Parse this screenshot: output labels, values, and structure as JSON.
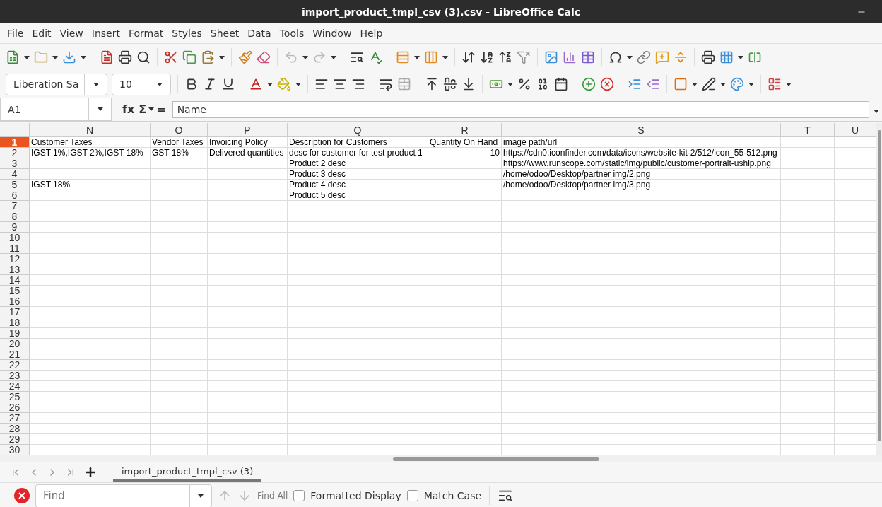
{
  "window": {
    "title": "import_product_tmpl_csv (3).csv - LibreOffice Calc"
  },
  "menu": [
    "File",
    "Edit",
    "View",
    "Insert",
    "Format",
    "Styles",
    "Sheet",
    "Data",
    "Tools",
    "Window",
    "Help"
  ],
  "history": {
    "undo": {
      "disabled": true
    },
    "redo": {
      "disabled": true
    }
  },
  "formatting": {
    "font": "Liberation Sa",
    "size": "10"
  },
  "formula_bar": {
    "cell": "A1",
    "function_label": "fx",
    "sum_label": "Σ",
    "equals_label": "=",
    "content": "Name"
  },
  "columns": [
    "N",
    "O",
    "P",
    "Q",
    "R",
    "S",
    "T",
    "U"
  ],
  "rows": [
    {
      "number": "1",
      "selected": true,
      "cells": [
        {
          "text": "Customer Taxes",
          "kind": "text"
        },
        {
          "text": "Vendor Taxes",
          "kind": "text"
        },
        {
          "text": "Invoicing Policy",
          "kind": "text"
        },
        {
          "text": "Description for Customers",
          "kind": "text"
        },
        {
          "text": "Quantity On Hand",
          "kind": "text"
        },
        {
          "text": "image path/url",
          "kind": "text"
        },
        null,
        null
      ]
    },
    {
      "number": "2",
      "selected": false,
      "cells": [
        {
          "text": "IGST 1%,IGST 2%,IGST 18%",
          "kind": "text"
        },
        {
          "text": "GST 18%",
          "kind": "text"
        },
        {
          "text": "Delivered quantities",
          "kind": "text"
        },
        {
          "text": "desc for customer for test product 1",
          "kind": "text"
        },
        {
          "text": "10",
          "kind": "number"
        },
        {
          "text": "https://cdn0.iconfinder.com/data/icons/website-kit-2/512/icon_55-512.png",
          "kind": "text"
        },
        null,
        null
      ]
    },
    {
      "number": "3",
      "selected": false,
      "cells": [
        null,
        null,
        null,
        {
          "text": "Product 2 desc",
          "kind": "text"
        },
        null,
        {
          "text": "https://www.runscope.com/static/img/public/customer-portrait-uship.png",
          "kind": "text"
        },
        null,
        null
      ]
    },
    {
      "number": "4",
      "selected": false,
      "cells": [
        null,
        null,
        null,
        {
          "text": "Product 3 desc",
          "kind": "text"
        },
        null,
        {
          "text": "/home/odoo/Desktop/partner img/2.png",
          "kind": "text"
        },
        null,
        null
      ]
    },
    {
      "number": "5",
      "selected": false,
      "cells": [
        {
          "text": "IGST 18%",
          "kind": "text"
        },
        null,
        null,
        {
          "text": "Product 4 desc",
          "kind": "text"
        },
        null,
        {
          "text": "/home/odoo/Desktop/partner img/3.png",
          "kind": "text"
        },
        null,
        null
      ]
    },
    {
      "number": "6",
      "selected": false,
      "cells": [
        null,
        null,
        null,
        {
          "text": "Product 5 desc",
          "kind": "text"
        },
        null,
        null,
        null,
        null
      ]
    },
    {
      "number": "7",
      "selected": false
    },
    {
      "number": "8",
      "selected": false
    },
    {
      "number": "9",
      "selected": false
    },
    {
      "number": "10",
      "selected": false
    },
    {
      "number": "11",
      "selected": false
    },
    {
      "number": "12",
      "selected": false
    },
    {
      "number": "13",
      "selected": false
    },
    {
      "number": "14",
      "selected": false
    },
    {
      "number": "15",
      "selected": false
    },
    {
      "number": "16",
      "selected": false
    },
    {
      "number": "17",
      "selected": false
    },
    {
      "number": "18",
      "selected": false
    },
    {
      "number": "19",
      "selected": false
    },
    {
      "number": "20",
      "selected": false
    },
    {
      "number": "21",
      "selected": false
    },
    {
      "number": "22",
      "selected": false
    },
    {
      "number": "23",
      "selected": false
    },
    {
      "number": "24",
      "selected": false
    },
    {
      "number": "25",
      "selected": false
    },
    {
      "number": "26",
      "selected": false
    },
    {
      "number": "27",
      "selected": false
    },
    {
      "number": "28",
      "selected": false
    },
    {
      "number": "29",
      "selected": false
    },
    {
      "number": "30",
      "selected": false
    }
  ],
  "sheet_tabs": [
    {
      "label": "import_product_tmpl_csv (3)",
      "selected": true
    }
  ],
  "find_bar": {
    "placeholder": "Find",
    "find_all": "Find All",
    "options": [
      {
        "label": "Formatted Display",
        "checked": false
      },
      {
        "label": "Match Case",
        "checked": false
      }
    ]
  }
}
